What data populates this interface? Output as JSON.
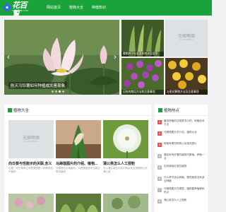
{
  "header": {
    "logo_text": "花百覧",
    "logo_sub": "HUABAIKE.COM",
    "nav": [
      "网站首页",
      "植物大全",
      "种植知识"
    ]
  },
  "banner": {
    "caption": "航天马铃薯如何种植成灾害现象",
    "active_slide": 3,
    "slide_count": 4
  },
  "side_cards": [
    {
      "caption": "樱桃种子在家里如何水培发芽"
    },
    {
      "caption": "",
      "noimg_label": "无缩略图",
      "noimg_sub": "NO THUMBNAIL"
    },
    {
      "caption": "石桂的栽培方法和注意事项"
    },
    {
      "caption": "五星花繁殖方法及注意事项"
    }
  ],
  "panel": {
    "title": "植物大全",
    "cards": [
      {
        "title": "向日葵与性能示的关联,含义",
        "desc": "位置：向日葵原生地是美国是一种美观花卉植物……",
        "noimg_label": "无缩略图",
        "noimg_sub": "NO THUMBNAIL"
      },
      {
        "title": "马蹄莲图片的介绍、植物...",
        "desc": "马蹄莲为天南星科、马蹄莲属多年生粗壮草本植物……"
      },
      {
        "title": "蒲公英怎么人工授粉",
        "desc": "可以蒲公英在花蕊中两朵花互相授粉分开蒲公英……"
      }
    ]
  },
  "hot": {
    "title": "植物热点",
    "items": [
      "番茄种植的过程是怎么样，种植技术方法",
      "马蹄莲图片的介绍，植物大全",
      "葡萄有哪些种类以及相关图片",
      "看起来有好看的植物可繁殖，养殖一点",
      "如何嫁接红宝石植物",
      "什么季节适合种植，哪些蔬菜没有适合种植",
      "马蹄莲图片在哪里，植物要养殖哪种热点",
      "蒲公英怎么人工授粉"
    ]
  }
}
